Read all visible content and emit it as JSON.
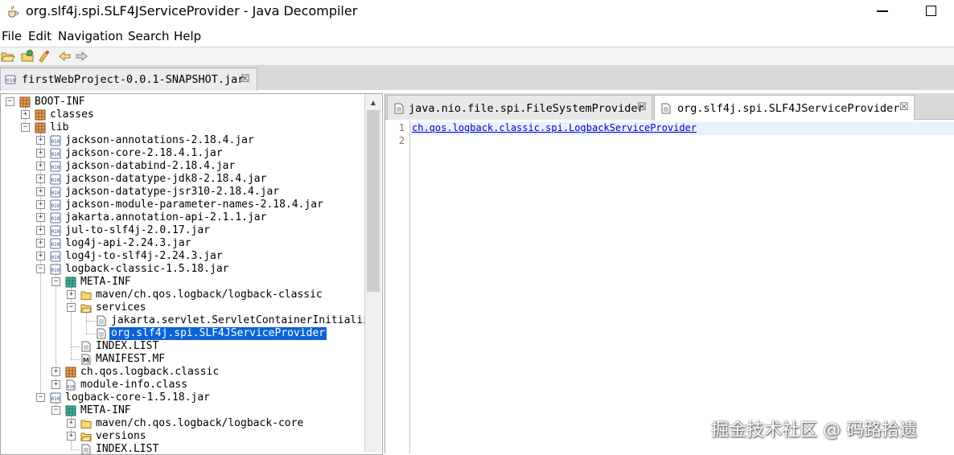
{
  "window": {
    "title": "org.slf4j.spi.SLF4JServiceProvider - Java Decompiler"
  },
  "menu": [
    "File",
    "Edit",
    "Navigation",
    "Search",
    "Help"
  ],
  "toolbar": {
    "icons": [
      "open-file-icon",
      "open-type-icon",
      "search-icon",
      "back-arrow-icon",
      "forward-arrow-icon"
    ]
  },
  "outer_tab": {
    "label": "firstWebProject-0.0.1-SNAPSHOT.jar",
    "close": "☒"
  },
  "tree": {
    "nodes": [
      {
        "label": "BOOT-INF",
        "icon": "package",
        "state": "open"
      },
      {
        "label": "classes",
        "icon": "package",
        "state": "closed"
      },
      {
        "label": "lib",
        "icon": "package",
        "state": "open"
      },
      {
        "label": "jackson-annotations-2.18.4.jar",
        "icon": "jar",
        "state": "closed"
      },
      {
        "label": "jackson-core-2.18.4.1.jar",
        "icon": "jar",
        "state": "closed"
      },
      {
        "label": "jackson-databind-2.18.4.jar",
        "icon": "jar",
        "state": "closed"
      },
      {
        "label": "jackson-datatype-jdk8-2.18.4.jar",
        "icon": "jar",
        "state": "closed"
      },
      {
        "label": "jackson-datatype-jsr310-2.18.4.jar",
        "icon": "jar",
        "state": "closed"
      },
      {
        "label": "jackson-module-parameter-names-2.18.4.jar",
        "icon": "jar",
        "state": "closed"
      },
      {
        "label": "jakarta.annotation-api-2.1.1.jar",
        "icon": "jar",
        "state": "closed"
      },
      {
        "label": "jul-to-slf4j-2.0.17.jar",
        "icon": "jar",
        "state": "closed"
      },
      {
        "label": "log4j-api-2.24.3.jar",
        "icon": "jar",
        "state": "closed"
      },
      {
        "label": "log4j-to-slf4j-2.24.3.jar",
        "icon": "jar",
        "state": "closed"
      },
      {
        "label": "logback-classic-1.5.18.jar",
        "icon": "jar",
        "state": "open"
      },
      {
        "label": "META-INF",
        "icon": "meta",
        "state": "open"
      },
      {
        "label": "maven/ch.qos.logback/logback-classic",
        "icon": "folder",
        "state": "closed"
      },
      {
        "label": "services",
        "icon": "folder-open",
        "state": "open"
      },
      {
        "label": "jakarta.servlet.ServletContainerInitializer",
        "icon": "file",
        "state": "leaf"
      },
      {
        "label": "org.slf4j.spi.SLF4JServiceProvider",
        "icon": "file",
        "state": "leaf",
        "selected": true
      },
      {
        "label": "INDEX.LIST",
        "icon": "file",
        "state": "leaf"
      },
      {
        "label": "MANIFEST.MF",
        "icon": "manifest",
        "state": "leaf"
      },
      {
        "label": "ch.qos.logback.classic",
        "icon": "package",
        "state": "closed"
      },
      {
        "label": "module-info.class",
        "icon": "class",
        "state": "closed"
      },
      {
        "label": "logback-core-1.5.18.jar",
        "icon": "jar",
        "state": "open"
      },
      {
        "label": "META-INF",
        "icon": "meta",
        "state": "open"
      },
      {
        "label": "maven/ch.qos.logback/logback-core",
        "icon": "folder",
        "state": "closed"
      },
      {
        "label": "versions",
        "icon": "folder-open",
        "state": "closed"
      },
      {
        "label": "INDEX.LIST",
        "icon": "file",
        "state": "leaf"
      }
    ]
  },
  "editor": {
    "tabs": [
      {
        "label": "java.nio.file.spi.FileSystemProvider",
        "close": "☒",
        "active": false
      },
      {
        "label": "org.slf4j.spi.SLF4JServiceProvider",
        "close": "☒",
        "active": true
      }
    ],
    "lines": [
      {
        "no": "1",
        "text": "ch.qos.logback.classic.spi.LogbackServiceProvider"
      },
      {
        "no": "2",
        "text": ""
      }
    ]
  },
  "watermark": "掘金技术社区 @ 码路拾遗"
}
